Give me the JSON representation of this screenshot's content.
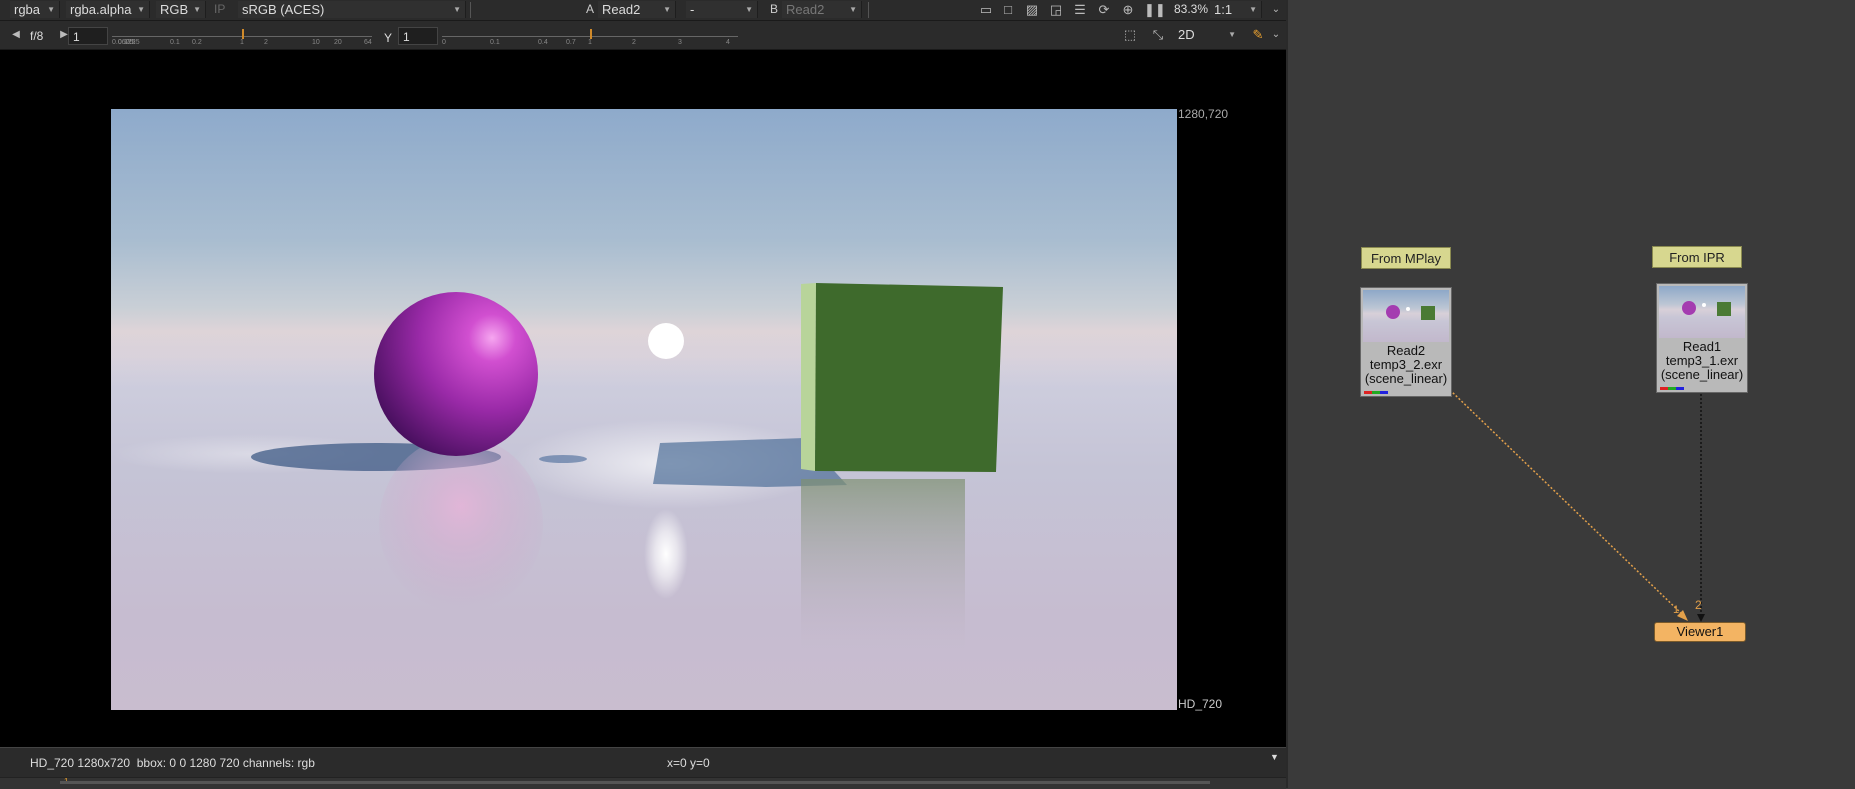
{
  "toolbar1": {
    "channels": "rgba",
    "alpha_channel": "rgba.alpha",
    "display_channels": "RGB",
    "ip_label": "IP",
    "colorspace": "sRGB (ACES)",
    "a_label": "A",
    "a_input": "Read2",
    "composite_op": "-",
    "b_label": "B",
    "b_input": "Read2",
    "zoom": "83.3%",
    "scale_ratio": "1:1"
  },
  "toolbar2": {
    "fstop": "f/8",
    "gain_value": "1",
    "gain_ticks": [
      "0.0625",
      "0.125",
      "0.25",
      "0.1",
      "0.2",
      "1",
      "2",
      "10",
      "20",
      "64"
    ],
    "gamma_label": "Y",
    "gamma_value": "1",
    "gamma_ticks": [
      "0",
      "0.1",
      "0.4",
      "0.7",
      "1",
      "2",
      "3",
      "4"
    ],
    "view_mode": "2D"
  },
  "viewer": {
    "top_right_coords": "1280,720",
    "format_label": "HD_720"
  },
  "statusbar": {
    "info": "HD_720 1280x720  bbox: 0 0 1280 720 channels: rgb",
    "cursor": "x=0 y=0"
  },
  "timeline": {
    "frame": "1"
  },
  "graph": {
    "backdrop_left": "From MPlay",
    "backdrop_right": "From IPR",
    "read2": {
      "name": "Read2",
      "file": "temp3_2.exr",
      "colorspace": "(scene_linear)"
    },
    "read1": {
      "name": "Read1",
      "file": "temp3_1.exr",
      "colorspace": "(scene_linear)"
    },
    "viewer_node": "Viewer1",
    "input_1": "1",
    "input_2": "2"
  },
  "colors": {
    "viewer_node": "#f3b463",
    "backdrop": "#d7d78f",
    "accent": "#d08a2a"
  }
}
